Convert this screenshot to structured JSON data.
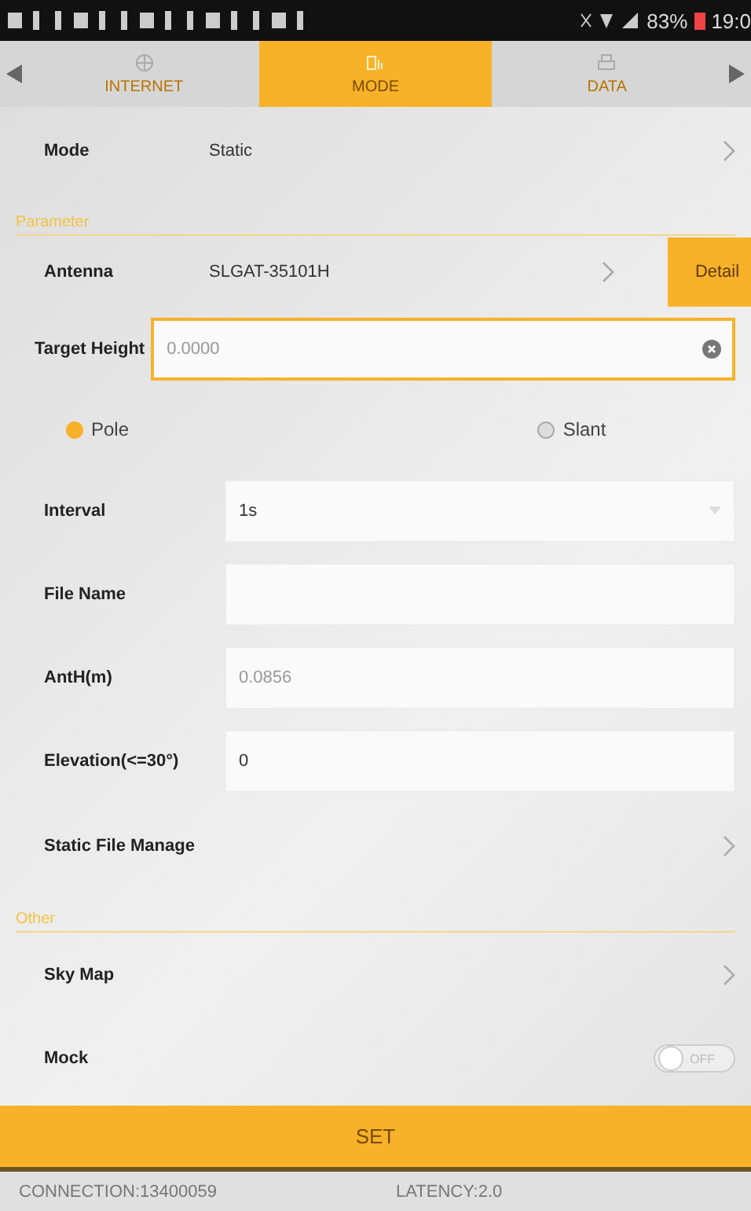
{
  "status_bar": {
    "battery": "83%",
    "time": "19:0"
  },
  "tabs": [
    {
      "label": "INTERNET",
      "selected": false,
      "kind": "globe"
    },
    {
      "label": "MODE",
      "selected": true,
      "kind": "device"
    },
    {
      "label": "DATA",
      "selected": false,
      "kind": "printer"
    }
  ],
  "mode_row": {
    "label": "Mode",
    "value": "Static"
  },
  "parameter_section": {
    "title": "Parameter"
  },
  "antenna": {
    "label": "Antenna",
    "value": "SLGAT-35101H",
    "button": "Detail"
  },
  "target_height": {
    "label": "Target Height",
    "placeholder": "0.0000",
    "focused": true
  },
  "height_type": [
    {
      "label": "Pole",
      "selected": true
    },
    {
      "label": "Slant",
      "selected": false
    }
  ],
  "fields": [
    {
      "kind": "select",
      "label": "Interval",
      "value": "1s"
    },
    {
      "kind": "input",
      "label": "File Name"
    },
    {
      "kind": "input",
      "label": "AntH(m)",
      "placeholder": "0.0856"
    },
    {
      "kind": "input",
      "label": "Elevation(<=30°)",
      "value": "0"
    }
  ],
  "static_file_manage": {
    "label": "Static File Manage"
  },
  "other_section": {
    "title": "Other"
  },
  "sky_map": {
    "label": "Sky Map"
  },
  "mock": {
    "label": "Mock",
    "on": false,
    "switch_text": "OFF"
  },
  "set_button": "SET",
  "footer": {
    "connection": "CONNECTION:13400059",
    "latency": "LATENCY:2.0"
  }
}
